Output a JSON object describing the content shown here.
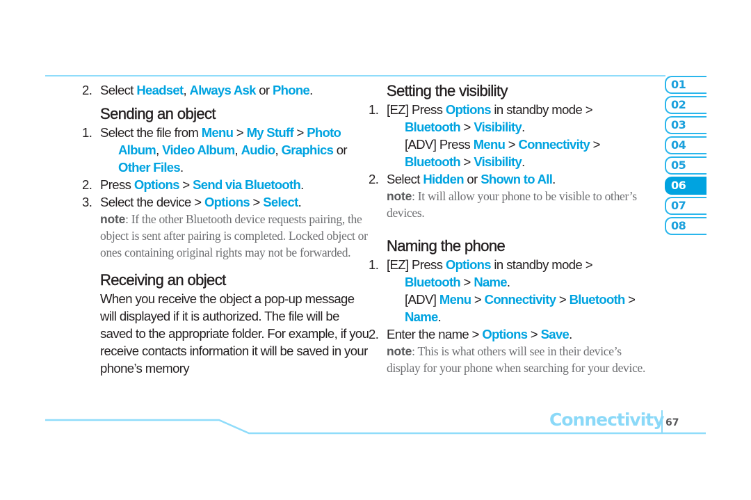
{
  "colors": {
    "accent": "#00a3e0",
    "text": "#231f20",
    "note": "#6d6e71",
    "rule": "#8fdcfa",
    "footer": "#8bd9f8"
  },
  "left": {
    "intro_step": {
      "num": "2.",
      "parts": [
        "Select ",
        "Headset",
        ", ",
        "Always Ask",
        " or ",
        "Phone",
        "."
      ]
    },
    "sending": {
      "title": "Sending an object",
      "step1": {
        "num": "1.",
        "parts": [
          "Select the file from ",
          "Menu",
          " > ",
          "My Stuff",
          " > ",
          "Photo Album",
          ", ",
          "Video Album",
          ", ",
          "Audio",
          ", ",
          "Graphics",
          " or ",
          "Other Files",
          "."
        ]
      },
      "step2": {
        "num": "2.",
        "parts": [
          "Press ",
          "Options",
          " > ",
          "Send via Bluetooth",
          "."
        ]
      },
      "step3": {
        "num": "3.",
        "parts": [
          "Select the device > ",
          "Options",
          " > ",
          "Select",
          "."
        ]
      },
      "note_label": "note",
      "note_text": ": If the other Bluetooth device requests pairing, the object is sent after pairing is completed. Locked object or ones containing original rights may not be forwarded."
    },
    "receiving": {
      "title": "Receiving an object",
      "body": "When you receive the object a pop-up message will displayed if it is authorized. The file will be saved to the appropriate folder. For example, if you receive contacts information it will be saved in your phone’s memory"
    }
  },
  "right": {
    "visibility": {
      "title": "Setting the visibility",
      "step1_ez": {
        "num": "1.",
        "parts": [
          "[EZ] Press ",
          "Options",
          " in standby mode > ",
          "Bluetooth",
          " > ",
          "Visibility",
          "."
        ]
      },
      "step1_adv": {
        "parts": [
          "[ADV] Press ",
          "Menu",
          " > ",
          "Connectivity",
          " > ",
          "Bluetooth",
          " > ",
          "Visibility",
          "."
        ]
      },
      "step2": {
        "num": "2.",
        "parts": [
          "Select ",
          "Hidden",
          " or ",
          "Shown to All",
          "."
        ]
      },
      "note_label": "note",
      "note_text": ": It  will allow your phone to be visible to other’s devices."
    },
    "naming": {
      "title": "Naming the phone",
      "step1_ez": {
        "num": "1.",
        "parts": [
          "[EZ] Press ",
          "Options",
          " in standby mode > ",
          "Bluetooth",
          " > ",
          "Name",
          "."
        ]
      },
      "step1_adv": {
        "parts": [
          "[ADV] ",
          "Menu",
          " > ",
          "Connectivity",
          " > ",
          "Bluetooth",
          " > ",
          "Name",
          "."
        ]
      },
      "step2": {
        "num": "2.",
        "parts": [
          "Enter the name > ",
          "Options",
          " > ",
          "Save",
          "."
        ]
      },
      "note_label": "note",
      "note_text": ": This is what others will see in their device’s display for your phone when searching for your device."
    }
  },
  "chapter_tabs": [
    {
      "label": "01",
      "active": false
    },
    {
      "label": "02",
      "active": false
    },
    {
      "label": "03",
      "active": false
    },
    {
      "label": "04",
      "active": false
    },
    {
      "label": "05",
      "active": false
    },
    {
      "label": "06",
      "active": true
    },
    {
      "label": "07",
      "active": false
    },
    {
      "label": "08",
      "active": false
    }
  ],
  "footer": {
    "section": "Connectivity",
    "page_number": "67"
  }
}
